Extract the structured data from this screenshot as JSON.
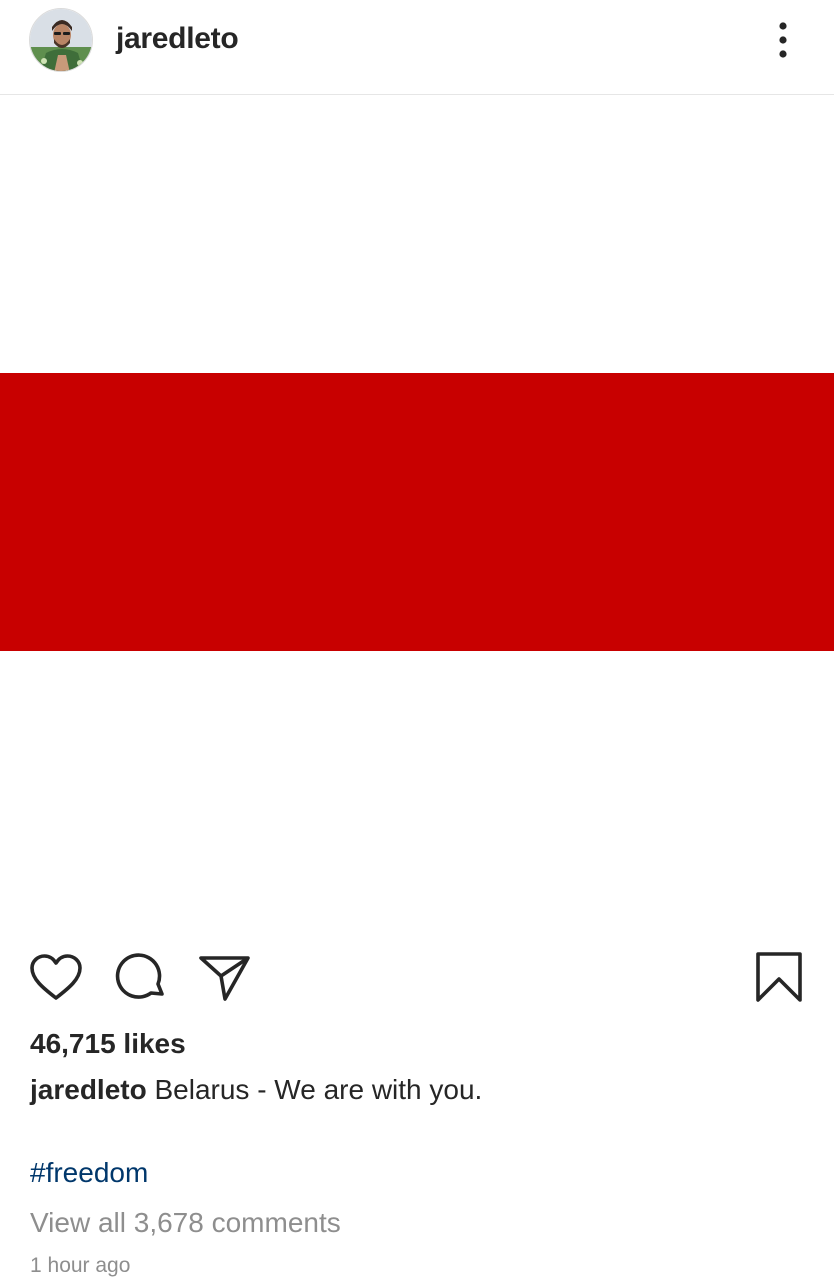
{
  "post": {
    "username": "jaredleto",
    "image": {
      "description_colors": {
        "white": "#ffffff",
        "red": "#c80000"
      }
    },
    "likes_text": "46,715 likes",
    "caption": {
      "username": "jaredleto",
      "text": "Belarus - We are with you."
    },
    "hashtag": "#freedom",
    "view_comments": "View all 3,678 comments",
    "timestamp": "1 hour ago"
  },
  "icons": {
    "avatar": "avatar",
    "more": "more-vertical-icon",
    "like": "heart-icon",
    "comment": "comment-icon",
    "share": "paper-plane-icon",
    "save": "bookmark-icon"
  },
  "colors": {
    "text": "#262626",
    "link": "#00376b",
    "muted": "#8e8e8e",
    "flag_red": "#c80000"
  }
}
